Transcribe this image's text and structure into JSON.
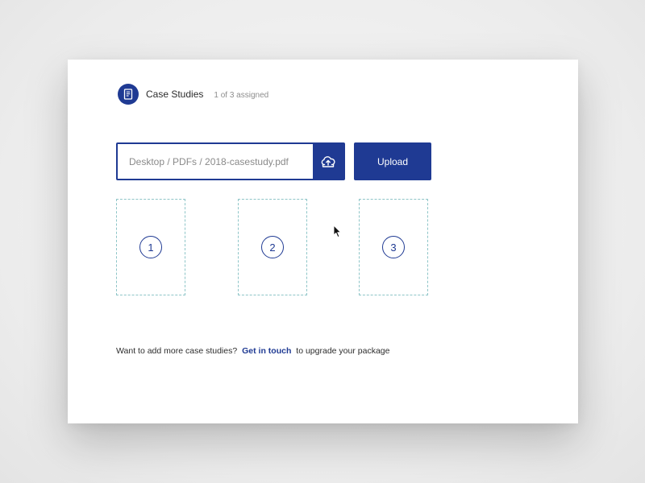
{
  "header": {
    "title": "Case Studies",
    "meta": "1 of 3 assigned",
    "icon": "book-icon"
  },
  "upload": {
    "path_value": "Desktop / PDFs / 2018-casestudy.pdf",
    "icon": "cloud-upload-icon",
    "button_label": "Upload"
  },
  "slots": [
    {
      "number": "1"
    },
    {
      "number": "2"
    },
    {
      "number": "3"
    }
  ],
  "footer": {
    "text_before": "Want to add more case studies?",
    "link_label": "Get in touch",
    "text_after": "to upgrade your package"
  },
  "colors": {
    "accent": "#1f3a93",
    "slot_border": "#8ec5c8",
    "background": "#ececec"
  }
}
